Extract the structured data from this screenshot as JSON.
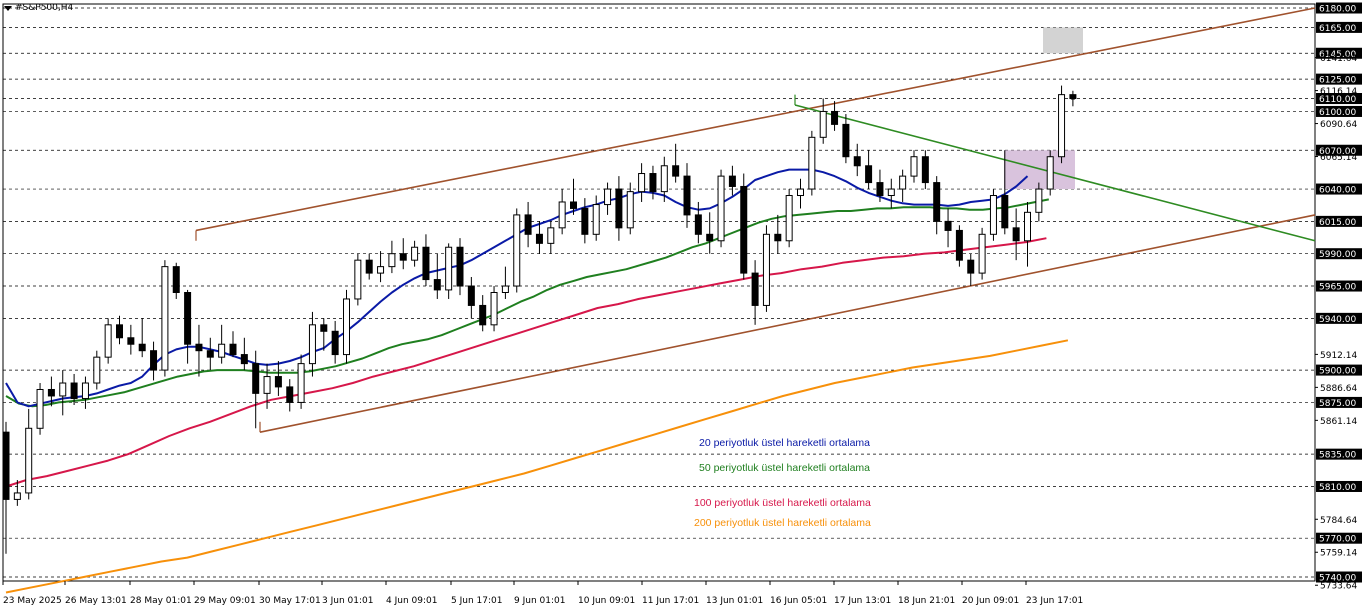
{
  "symbol": "#S&P500,H4",
  "colors": {
    "ema20": "#0a1aa6",
    "ema50": "#1f7f1f",
    "ema100": "#d6174a",
    "ema200": "#f7900a",
    "channel": "#a0522d",
    "trendline": "#2e8b22",
    "bull": "#ffffff",
    "bear": "#000000",
    "zone_gray": "#d3d3d3",
    "zone_purple": "#d9c3dd",
    "grid": "#000000"
  },
  "legend": {
    "ema20": "20 periyotluk üstel hareketli ortalama",
    "ema50": "50 periyotluk üstel hareketli ortalama",
    "ema100": "100 periyotluk üstel hareketli ortalama",
    "ema200": "200 periyotluk üstel hareketli ortalama"
  },
  "chart_data": {
    "type": "candlestick",
    "title": "#S&P500,H4",
    "ylim": [
      5733.64,
      6183
    ],
    "dashed_levels": [
      6180,
      6165,
      6145,
      6125,
      6110,
      6100,
      6070,
      6040,
      6015,
      5990,
      5965,
      5940,
      5900,
      5875,
      5835,
      5810,
      5770,
      5740
    ],
    "plain_ticks": [
      "6141.64",
      "6116.14",
      "6090.64",
      "6065.14",
      "5912.14",
      "5886.64",
      "5861.14",
      "5784.64",
      "5759.14",
      "5733.64"
    ],
    "current_price_label": "6110.00",
    "x_tick_labels": [
      "23 May 2025",
      "26 May 13:01",
      "28 May 01:01",
      "29 May 09:01",
      "30 May 17:01",
      "3 Jun 01:01",
      "4 Jun 09:01",
      "5 Jun 17:01",
      "9 Jun 01:01",
      "10 Jun 09:01",
      "11 Jun 17:01",
      "13 Jun 01:01",
      "16 Jun 05:01",
      "17 Jun 13:01",
      "18 Jun 21:01",
      "20 Jun 09:01",
      "23 Jun 17:01"
    ],
    "candles": [
      [
        5852,
        5860,
        5758,
        5800
      ],
      [
        5800,
        5815,
        5795,
        5805
      ],
      [
        5805,
        5870,
        5800,
        5855
      ],
      [
        5855,
        5890,
        5850,
        5885
      ],
      [
        5885,
        5895,
        5872,
        5880
      ],
      [
        5880,
        5900,
        5865,
        5890
      ],
      [
        5890,
        5897,
        5873,
        5878
      ],
      [
        5878,
        5895,
        5870,
        5890
      ],
      [
        5890,
        5915,
        5885,
        5910
      ],
      [
        5910,
        5940,
        5905,
        5935
      ],
      [
        5935,
        5942,
        5920,
        5925
      ],
      [
        5925,
        5935,
        5912,
        5920
      ],
      [
        5920,
        5940,
        5910,
        5915
      ],
      [
        5915,
        5922,
        5892,
        5900
      ],
      [
        5900,
        5985,
        5895,
        5980
      ],
      [
        5980,
        5983,
        5955,
        5960
      ],
      [
        5960,
        5962,
        5905,
        5920
      ],
      [
        5920,
        5935,
        5895,
        5915
      ],
      [
        5915,
        5925,
        5900,
        5910
      ],
      [
        5910,
        5935,
        5905,
        5920
      ],
      [
        5920,
        5930,
        5910,
        5912
      ],
      [
        5912,
        5925,
        5900,
        5905
      ],
      [
        5905,
        5915,
        5855,
        5882
      ],
      [
        5882,
        5905,
        5870,
        5895
      ],
      [
        5895,
        5907,
        5880,
        5887
      ],
      [
        5887,
        5893,
        5868,
        5875
      ],
      [
        5875,
        5912,
        5870,
        5905
      ],
      [
        5905,
        5945,
        5895,
        5935
      ],
      [
        5935,
        5940,
        5915,
        5930
      ],
      [
        5930,
        5938,
        5905,
        5912
      ],
      [
        5912,
        5962,
        5905,
        5955
      ],
      [
        5955,
        5990,
        5950,
        5985
      ],
      [
        5985,
        5990,
        5970,
        5975
      ],
      [
        5975,
        5992,
        5968,
        5980
      ],
      [
        5980,
        6000,
        5975,
        5990
      ],
      [
        5990,
        6002,
        5978,
        5985
      ],
      [
        5985,
        6000,
        5980,
        5995
      ],
      [
        5995,
        6005,
        5965,
        5970
      ],
      [
        5970,
        5990,
        5955,
        5962
      ],
      [
        5962,
        5998,
        5955,
        5995
      ],
      [
        5995,
        6002,
        5958,
        5965
      ],
      [
        5965,
        5972,
        5940,
        5950
      ],
      [
        5950,
        5958,
        5930,
        5935
      ],
      [
        5935,
        5965,
        5930,
        5960
      ],
      [
        5960,
        5980,
        5955,
        5965
      ],
      [
        5965,
        6025,
        5960,
        6020
      ],
      [
        6020,
        6030,
        5995,
        6005
      ],
      [
        6005,
        6015,
        5990,
        5998
      ],
      [
        5998,
        6015,
        5990,
        6010
      ],
      [
        6010,
        6040,
        6005,
        6030
      ],
      [
        6030,
        6048,
        6020,
        6025
      ],
      [
        6025,
        6033,
        5998,
        6005
      ],
      [
        6005,
        6035,
        6000,
        6028
      ],
      [
        6028,
        6045,
        6020,
        6040
      ],
      [
        6040,
        6050,
        6000,
        6010
      ],
      [
        6010,
        6045,
        6005,
        6038
      ],
      [
        6038,
        6060,
        6030,
        6052
      ],
      [
        6052,
        6058,
        6032,
        6038
      ],
      [
        6038,
        6065,
        6030,
        6058
      ],
      [
        6058,
        6075,
        6045,
        6050
      ],
      [
        6050,
        6060,
        6010,
        6020
      ],
      [
        6020,
        6030,
        5998,
        6005
      ],
      [
        6005,
        6022,
        5990,
        6000
      ],
      [
        6000,
        6055,
        5995,
        6050
      ],
      [
        6050,
        6058,
        6035,
        6042
      ],
      [
        6042,
        6052,
        5970,
        5975
      ],
      [
        5975,
        5985,
        5935,
        5950
      ],
      [
        5950,
        6012,
        5945,
        6005
      ],
      [
        6005,
        6020,
        5990,
        6000
      ],
      [
        6000,
        6040,
        5995,
        6035
      ],
      [
        6035,
        6048,
        6025,
        6040
      ],
      [
        6040,
        6085,
        6035,
        6080
      ],
      [
        6080,
        6110,
        6075,
        6100
      ],
      [
        6100,
        6108,
        6085,
        6090
      ],
      [
        6090,
        6098,
        6060,
        6065
      ],
      [
        6065,
        6075,
        6050,
        6058
      ],
      [
        6058,
        6070,
        6040,
        6045
      ],
      [
        6045,
        6055,
        6030,
        6035
      ],
      [
        6035,
        6048,
        6025,
        6040
      ],
      [
        6040,
        6055,
        6030,
        6050
      ],
      [
        6050,
        6070,
        6045,
        6065
      ],
      [
        6065,
        6070,
        6040,
        6045
      ],
      [
        6045,
        6050,
        6005,
        6015
      ],
      [
        6015,
        6025,
        5995,
        6008
      ],
      [
        6008,
        6012,
        5980,
        5985
      ],
      [
        5985,
        5990,
        5965,
        5975
      ],
      [
        5975,
        6010,
        5970,
        6005
      ],
      [
        6005,
        6040,
        6000,
        6035
      ],
      [
        6035,
        6070,
        6005,
        6010
      ],
      [
        6010,
        6025,
        5985,
        6000
      ],
      [
        6000,
        6030,
        5980,
        6022
      ],
      [
        6022,
        6045,
        6015,
        6040
      ],
      [
        6040,
        6070,
        6035,
        6065
      ],
      [
        6065,
        6120,
        6060,
        6113
      ],
      [
        6113,
        6116,
        6104,
        6110
      ]
    ],
    "series": [
      {
        "name": "20 periyotluk üstel hareketli ortalama",
        "values": [
          5890,
          5875,
          5872,
          5874,
          5876,
          5878,
          5879,
          5880,
          5882,
          5885,
          5888,
          5890,
          5895,
          5904,
          5912,
          5916,
          5918,
          5918,
          5916,
          5914,
          5911,
          5908,
          5905,
          5904,
          5905,
          5907,
          5910,
          5914,
          5917,
          5924,
          5930,
          5937,
          5945,
          5953,
          5960,
          5966,
          5971,
          5975,
          5977,
          5979,
          5981,
          5985,
          5990,
          5995,
          6000,
          6005,
          6010,
          6013,
          6016,
          6020,
          6023,
          6026,
          6028,
          6031,
          6033,
          6036,
          6038,
          6037,
          6035,
          6030,
          6026,
          6024,
          6025,
          6029,
          6034,
          6040,
          6047,
          6050,
          6053,
          6055,
          6055,
          6055,
          6053,
          6050,
          6046,
          6041,
          6037,
          6034,
          6031,
          6029,
          6028,
          6028,
          6028,
          6027,
          6028,
          6030,
          6031,
          6032,
          6036,
          6042,
          6050
        ]
      },
      {
        "name": "50 periyotluk üstel hareketli ortalama",
        "values": [
          5880,
          5874,
          5872,
          5873,
          5875,
          5876,
          5877,
          5879,
          5881,
          5883,
          5886,
          5889,
          5892,
          5895,
          5897,
          5899,
          5900,
          5900,
          5900,
          5899,
          5898,
          5898,
          5898,
          5899,
          5901,
          5903,
          5906,
          5909,
          5913,
          5917,
          5920,
          5922,
          5924,
          5927,
          5931,
          5935,
          5939,
          5943,
          5948,
          5953,
          5957,
          5962,
          5966,
          5969,
          5972,
          5974,
          5976,
          5978,
          5981,
          5984,
          5987,
          5991,
          5995,
          5998,
          6002,
          6006,
          6010,
          6014,
          6017,
          6019,
          6020,
          6021,
          6022,
          6023,
          6023,
          6024,
          6025,
          6025,
          6026,
          6026,
          6026,
          6025,
          6025,
          6024,
          6024,
          6025,
          6026,
          6028,
          6030,
          6032
        ]
      },
      {
        "name": "100 periyotluk üstel hareketli ortalama",
        "values": [
          5810,
          5815,
          5818,
          5822,
          5826,
          5830,
          5835,
          5842,
          5849,
          5855,
          5860,
          5866,
          5872,
          5877,
          5880,
          5883,
          5886,
          5890,
          5895,
          5899,
          5903,
          5908,
          5913,
          5918,
          5923,
          5928,
          5933,
          5938,
          5943,
          5948,
          5951,
          5955,
          5958,
          5961,
          5964,
          5967,
          5970,
          5973,
          5975,
          5978,
          5980,
          5983,
          5985,
          5987,
          5988,
          5990,
          5991,
          5993,
          5995,
          5997,
          5999,
          6002
        ]
      },
      {
        "name": "200 periyotluk üstel hareketli ortalama",
        "values": [
          5728,
          5732,
          5736,
          5740,
          5744,
          5748,
          5752,
          5755,
          5760,
          5765,
          5770,
          5775,
          5780,
          5785,
          5790,
          5795,
          5800,
          5805,
          5810,
          5815,
          5820,
          5826,
          5832,
          5838,
          5844,
          5850,
          5856,
          5862,
          5868,
          5874,
          5880,
          5885,
          5890,
          5894,
          5898,
          5902,
          5905,
          5908,
          5911,
          5915,
          5919,
          5923
        ]
      }
    ]
  }
}
